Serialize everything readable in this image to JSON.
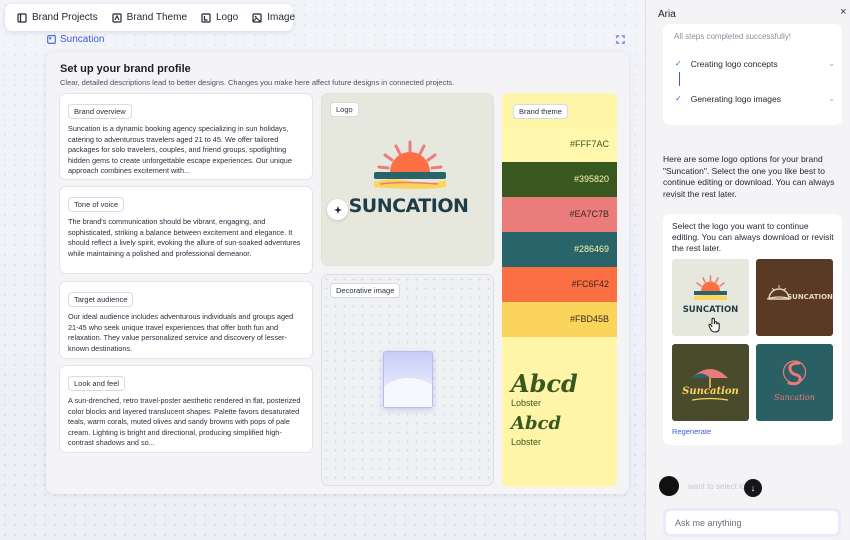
{
  "toolbar": {
    "items": [
      {
        "label": "Brand Projects",
        "icon": "book-icon"
      },
      {
        "label": "Brand Theme",
        "icon": "palette-icon"
      },
      {
        "label": "Logo",
        "icon": "logo-icon"
      },
      {
        "label": "Image",
        "icon": "image-icon"
      }
    ]
  },
  "project": {
    "name": "Suncation"
  },
  "profile": {
    "title": "Set up your brand profile",
    "subtitle": "Clear, detailed descriptions lead to better designs. Changes you make here affect future designs in connected projects.",
    "sections": [
      {
        "label": "Brand overview",
        "text": "Suncation is a dynamic booking agency specializing in sun holidays, catering to adventurous travelers aged 21 to 45. We offer tailored packages for solo travelers, couples, and friend groups, spotlighting hidden gems to create unforgettable escape experiences. Our unique approach combines excitement with..."
      },
      {
        "label": "Tone of voice",
        "text": "The brand's communication should be vibrant, engaging, and sophisticated, striking a balance between excitement and elegance. It should reflect a lively spirit, evoking the allure of sun-soaked adventures while maintaining a polished and professional demeanor."
      },
      {
        "label": "Target audience",
        "text": "Our ideal audience includes adventurous individuals and groups aged 21-45 who seek unique travel experiences that offer both fun and relaxation. They value personalized service and discovery of lesser-known destinations."
      },
      {
        "label": "Look and feel",
        "text": "A sun-drenched, retro travel-poster aesthetic rendered in flat, posterized color blocks and layered translucent shapes. Palette favors desaturated teals, warm corals, muted olives and sandy browns with pops of pale cream. Lighting is bright and directional, producing simplified high-contrast shadows and so..."
      }
    ],
    "logo": {
      "label": "Logo",
      "wordmark": "SUNCATION"
    },
    "decorative": {
      "label": "Decorative image"
    },
    "theme": {
      "label": "Brand theme",
      "colors": [
        {
          "hex": "#FFF7AC",
          "text_color": "#395820"
        },
        {
          "hex": "#395820",
          "text_color": "#FFF7AC"
        },
        {
          "hex": "#EA7C7B",
          "text_color": "#3b2a22"
        },
        {
          "hex": "#286469",
          "text_color": "#FFF7AC"
        },
        {
          "hex": "#FC6F42",
          "text_color": "#3b2a22"
        },
        {
          "hex": "#FBD45B",
          "text_color": "#3b2a22"
        }
      ],
      "fonts": [
        {
          "sample": "Abcd",
          "name": "Lobster"
        },
        {
          "sample": "Abcd",
          "name": "Lobster"
        }
      ]
    }
  },
  "aria": {
    "title": "Aria",
    "close": "×",
    "steps_status": "All steps completed successfully!",
    "steps": [
      {
        "label": "Creating logo concepts"
      },
      {
        "label": "Generating logo images"
      }
    ],
    "message": "Here are some logo options for your brand \"Suncation\". Select the one you like best to continue editing or download. You can always revisit the rest later.",
    "select_prompt": "Select the logo you want to continue editing. You can always download or revisit the rest later.",
    "logo_options": [
      {
        "text": "SUNCATION",
        "bg": "#e6e8de"
      },
      {
        "text": "SUNCATION",
        "bg": "#5a3a24"
      },
      {
        "text": "Suncation",
        "bg": "#4a4a2c"
      },
      {
        "text": "Suncation",
        "bg": "#2a5f63"
      }
    ],
    "regenerate": "Regenerate",
    "ghost_message": "want to select logo.",
    "input_placeholder": "Ask me anything"
  }
}
